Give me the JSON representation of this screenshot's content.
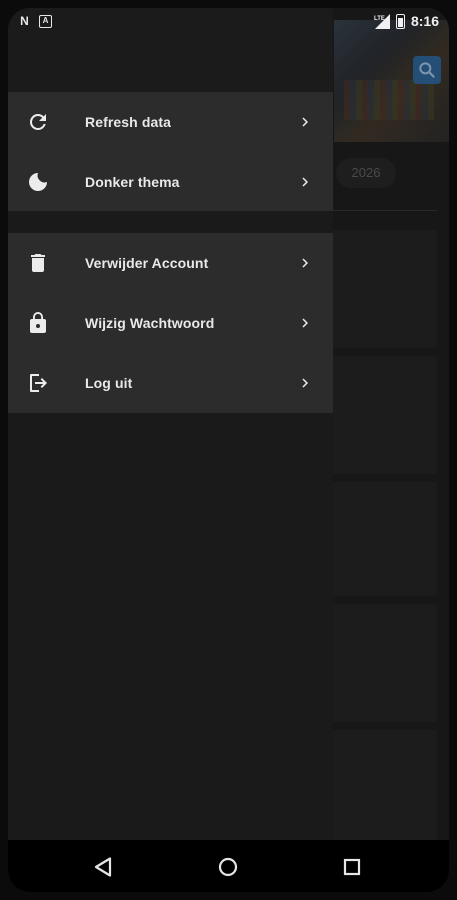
{
  "status_bar": {
    "left_icons": [
      "notification-n-icon",
      "notification-a-icon"
    ],
    "time": "8:16",
    "signal_label": "LTE"
  },
  "background": {
    "year_chip": "2026"
  },
  "drawer": {
    "group1": [
      {
        "label": "Refresh data",
        "icon": "refresh-icon"
      },
      {
        "label": "Donker thema",
        "icon": "moon-icon"
      }
    ],
    "group2": [
      {
        "label": "Verwijder Account",
        "icon": "trash-icon"
      },
      {
        "label": "Wijzig Wachtwoord",
        "icon": "lock-icon"
      },
      {
        "label": "Log uit",
        "icon": "logout-icon"
      }
    ]
  },
  "nav_bar": {
    "buttons": [
      "back-icon",
      "home-icon",
      "recents-icon"
    ]
  },
  "colors": {
    "drawer_bg": "#1a1a1a",
    "group_bg": "#2c2c2c",
    "text": "#e9e9e9",
    "accent": "#1f5f9a"
  }
}
